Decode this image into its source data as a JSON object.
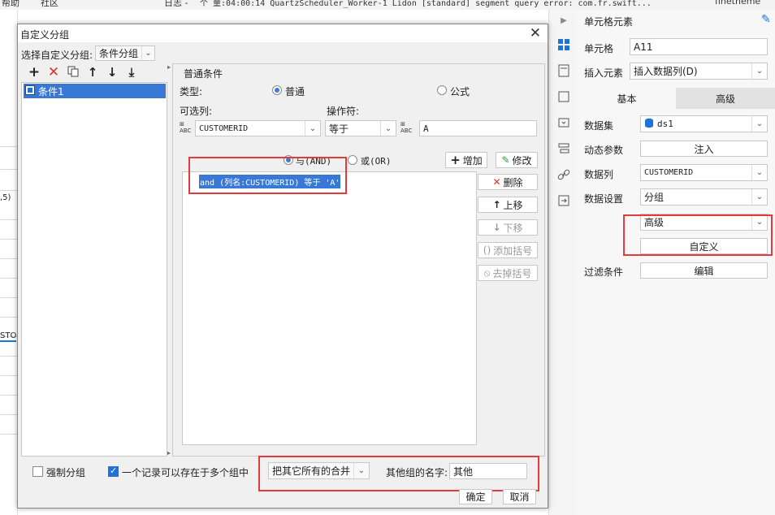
{
  "background": {
    "top_fragments": [
      "帮助",
      "社区",
      "日志 -",
      "个 量:04:00:14 QuartzScheduler_Worker-1 Lidon [standard] segment query error: com.fr.swift...",
      "finetheme"
    ],
    "sheet_snippets": [
      ",5)",
      "STO"
    ]
  },
  "dialog": {
    "title": "自定义分组",
    "choose_label": "选择自定义分组:",
    "choose_value": "条件分组",
    "tree_items": [
      "条件1"
    ],
    "section_title": "普通条件",
    "type_label": "类型:",
    "type_normal": "普通",
    "type_formula": "公式",
    "column_label": "可选列:",
    "operator_label": "操作符:",
    "column_value": "CUSTOMERID",
    "operator_value": "等于",
    "value_text": "A",
    "and_label": "与(AND)",
    "or_label": "或(OR)",
    "add_button": "增加",
    "modify_button": "修改",
    "condition_text": "and (列名:CUSTOMERID) 等于 'A'",
    "delete_button": "删除",
    "up_button": "上移",
    "down_button": "下移",
    "add_bracket_button": "添加括号",
    "remove_bracket_button": "去掉括号",
    "force_group": "强制分组",
    "multi_group": "一个记录可以存在于多个组中",
    "others_select": "把其它所有的合并",
    "others_name_label": "其他组的名字:",
    "others_name_value": "其他",
    "ok_button": "确定",
    "cancel_button": "取消"
  },
  "panel": {
    "title": "单元格元素",
    "cell_label": "单元格",
    "cell_value": "A11",
    "insert_label": "插入元素",
    "insert_value": "插入数据列(D)",
    "tab_basic": "基本",
    "tab_advanced": "高级",
    "dataset_label": "数据集",
    "dataset_value": "ds1",
    "dynamic_label": "动态参数",
    "dynamic_button": "注入",
    "column_label": "数据列",
    "column_value": "CUSTOMERID",
    "setting_label": "数据设置",
    "setting_value": "分组",
    "advanced_value": "高级",
    "custom_button": "自定义",
    "filter_label": "过滤条件",
    "filter_button": "编辑"
  },
  "colors": {
    "accent": "#1e73d8",
    "highlight_red": "#e33b3b",
    "selection": "#3a78d6",
    "tab_active_bg": "#f7f7f7",
    "tab_inactive_bg": "#e2e2e2"
  },
  "icons": [
    "add-icon",
    "delete-icon",
    "copy-icon",
    "arrow-up-icon",
    "arrow-down-icon",
    "move-bottom-icon",
    "cell-icon",
    "close-icon",
    "database-icon",
    "chevron-down-icon"
  ]
}
